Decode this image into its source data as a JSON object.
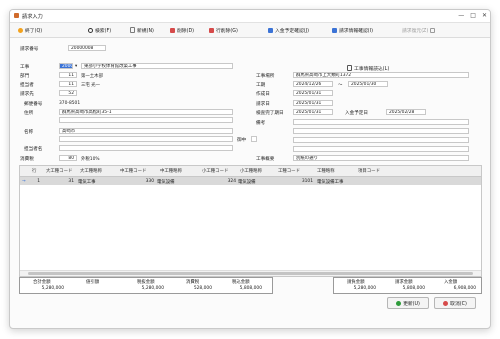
{
  "window": {
    "title": "請求入力",
    "controls": [
      "—",
      "□",
      "✕"
    ]
  },
  "toolbar": [
    {
      "label": "終了(Q)",
      "icon": "exit-icon",
      "color": "#f3a21d",
      "enabled": true
    },
    {
      "label": "検索(F)",
      "icon": "search-icon",
      "color": "#333333",
      "enabled": true
    },
    {
      "label": "新規(N)",
      "icon": "new-doc-icon",
      "color": "#7a7a7a",
      "enabled": true
    },
    {
      "label": "削除(D)",
      "icon": "delete-icon",
      "color": "#d64a4a",
      "enabled": true
    },
    {
      "label": "行削除(G)",
      "icon": "row-delete-icon",
      "color": "#d64a4a",
      "enabled": true
    },
    {
      "label": "入金予定確認(J)",
      "icon": "payment-schedule-icon",
      "color": "#3b73d6",
      "enabled": true
    },
    {
      "label": "請求情報確認(I)",
      "icon": "invoice-info-icon",
      "color": "#3b73d6",
      "enabled": true
    },
    {
      "label": "請求復元(Z)",
      "icon": "restore-icon",
      "color": "#9a9a9a",
      "enabled": false
    }
  ],
  "header": {
    "invoice_no_label": "請求番号",
    "invoice_no": "20000008",
    "left": {
      "project_label": "工事",
      "project_code": "2000",
      "project_name": "東部小学校体育館改築工事",
      "dept_label": "部門",
      "dept_code": "11",
      "dept_name": "第一土木部",
      "staff_label": "担当者",
      "staff_code": "11",
      "staff_name": "三宅 光一",
      "client_label": "請求先",
      "client_code": "52",
      "postal_label": "郵便番号",
      "postal": "370-8501",
      "address_label": "住所",
      "address": "群馬県高崎市高松町35-1",
      "name_label": "名称",
      "name": "高崎市",
      "tax_label": "消費税",
      "tax_code": "80",
      "tax_name": "外税10%",
      "contact_label": "担当者名",
      "honorific_label": "御中"
    },
    "right": {
      "project_info_label": "工事情報読込(L)",
      "site_label": "工事場所",
      "site": "群馬県高崎市上大類町1372",
      "period_label": "工期",
      "period_from": "2024/12/26",
      "period_sep": "〜",
      "period_to": "2025/01/30",
      "created_label": "作成日",
      "created": "2025/01/31",
      "invoice_date_label": "請求日",
      "invoice_date": "2025/01/31",
      "inspection_label": "検査完了期日",
      "inspection": "2025/01/31",
      "payment_due_label": "入金予定日",
      "payment_due": "2025/02/28",
      "remarks_label": "備考",
      "summary_label": "工事概要",
      "summary": "別紙の通り"
    }
  },
  "grid": {
    "columns": [
      "行",
      "大工種コード",
      "大工種略称",
      "中工種コード",
      "中工種略称",
      "小工種コード",
      "小工種略称",
      "工種コード",
      "工種略称",
      "項目コード"
    ],
    "rows": [
      {
        "marker": "→",
        "row": "1",
        "major_code": "31",
        "major_name": "電気工事",
        "mid_code": "330",
        "mid_name": "電気設備",
        "minor_code": "324",
        "minor_name": "電気設備",
        "work_code": "3101",
        "work_name": "電気設備工事",
        "item_code": ""
      }
    ]
  },
  "totals_left": {
    "headers": [
      "合計金額",
      "値引額",
      "税抜金額",
      "消費税",
      "税込金額"
    ],
    "values": [
      "5,280,000",
      "",
      "5,280,000",
      "528,000",
      "5,808,000"
    ]
  },
  "totals_right": {
    "headers": [
      "請負金額",
      "請求金額",
      "入金額"
    ],
    "values": [
      "5,280,000",
      "5,808,000",
      "6,908,000"
    ]
  },
  "actions": {
    "update_label": "更新(U)",
    "cancel_label": "取消(C)",
    "update_color": "#2e9b3b",
    "cancel_color": "#d64a4a"
  }
}
